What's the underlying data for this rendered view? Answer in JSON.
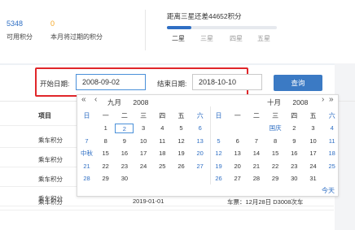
{
  "points": {
    "available_value": "5348",
    "available_label": "可用积分",
    "expiring_value": "0",
    "expiring_label": "本月将过期的积分"
  },
  "rank": {
    "title": "距离三星还差44652积分",
    "levels": [
      "二星",
      "三星",
      "四星",
      "五星"
    ],
    "progress": 0.22
  },
  "filter": {
    "start_label": "开始日期:",
    "start_value": "2008-09-02",
    "end_label": "结束日期:",
    "end_value": "2018-10-10",
    "query_label": "查询"
  },
  "table": {
    "header_project": "项目",
    "rows": [
      {
        "project": "乘车积分"
      },
      {
        "project": "乘车积分"
      },
      {
        "project": "乘车积分"
      },
      {
        "project": "乘车积分"
      },
      {
        "project": "乘车积分",
        "date": "2019-01-01",
        "detail": "车票：12月28日 D3008次车"
      }
    ]
  },
  "calendar": {
    "nav_prev_year": "«",
    "nav_prev_month": "‹",
    "nav_next_month": "›",
    "nav_next_year": "»",
    "left_month": "九月",
    "left_year": "2008",
    "right_month": "十月",
    "right_year": "2008",
    "weekdays": [
      "日",
      "一",
      "二",
      "三",
      "四",
      "五",
      "六"
    ],
    "left_days": [
      [
        "",
        "1",
        "2",
        "3",
        "4",
        "5",
        "6"
      ],
      [
        "7",
        "8",
        "9",
        "10",
        "11",
        "12",
        "13"
      ],
      [
        "中秋",
        "15",
        "16",
        "17",
        "18",
        "19",
        "20"
      ],
      [
        "21",
        "22",
        "23",
        "24",
        "25",
        "26",
        "27"
      ],
      [
        "28",
        "29",
        "30",
        "",
        "",
        "",
        ""
      ]
    ],
    "right_days": [
      [
        "",
        "",
        "",
        "国庆",
        "2",
        "3",
        "4"
      ],
      [
        "5",
        "6",
        "7",
        "8",
        "9",
        "10",
        "11"
      ],
      [
        "12",
        "13",
        "14",
        "15",
        "16",
        "17",
        "18"
      ],
      [
        "19",
        "20",
        "21",
        "22",
        "23",
        "24",
        "25"
      ],
      [
        "26",
        "27",
        "28",
        "29",
        "30",
        "31",
        ""
      ]
    ],
    "today_label": "今天"
  },
  "colors": {
    "accent": "#2f6fc4",
    "highlight_box": "#e0262a",
    "expiring": "#f5a623"
  }
}
